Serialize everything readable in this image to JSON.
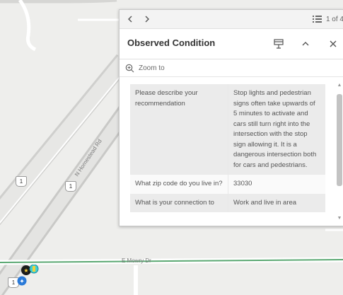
{
  "map": {
    "roads": {
      "homestead": "N Homestead Rd",
      "mowry": "E Mowry Dr"
    },
    "shields": [
      "1",
      "1",
      "1"
    ],
    "route_color": "#5aa872"
  },
  "popup": {
    "nav": {
      "prev_icon": "chevron-left-icon",
      "next_icon": "chevron-right-icon",
      "counter": "1 of 4"
    },
    "title": "Observed Condition",
    "zoom_label": "Zoom to",
    "rows": [
      {
        "key": "Please describe your recommendation",
        "value": "Stop lights and pedestrian signs often take upwards of 5 minutes to activate and cars still turn right into the intersection with the stop sign allowing it. It is a dangerous intersection both for cars and pedestrians."
      },
      {
        "key": "What zip code do you live in?",
        "value": "33030"
      },
      {
        "key": "What is your connection to",
        "value": "Work and live in area"
      }
    ]
  }
}
